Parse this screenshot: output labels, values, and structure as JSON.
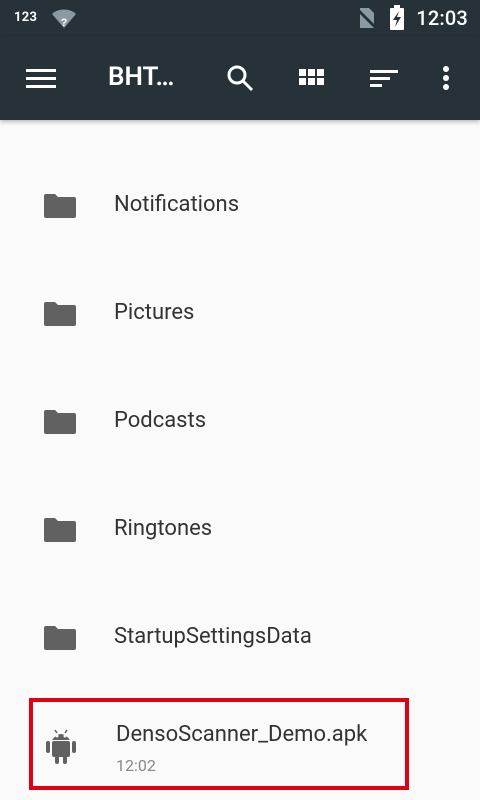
{
  "status_bar": {
    "left_text": "123",
    "time": "12:03",
    "icons": [
      "wifi-unknown-icon",
      "no-sim-icon",
      "battery-charging-icon"
    ]
  },
  "toolbar": {
    "title": "BHT…",
    "icons": [
      "menu-icon",
      "search-icon",
      "grid-view-icon",
      "sort-icon",
      "more-vert-icon"
    ]
  },
  "files": [
    {
      "name": "Notifications",
      "type": "folder"
    },
    {
      "name": "Pictures",
      "type": "folder"
    },
    {
      "name": "Podcasts",
      "type": "folder"
    },
    {
      "name": "Ringtones",
      "type": "folder"
    },
    {
      "name": "StartupSettingsData",
      "type": "folder"
    }
  ],
  "apk": {
    "name": "DensoScanner_Demo.apk",
    "time": "12:02"
  },
  "colors": {
    "app_bar": "#263238",
    "highlight": "#e00014",
    "icon_gray": "#616161"
  }
}
